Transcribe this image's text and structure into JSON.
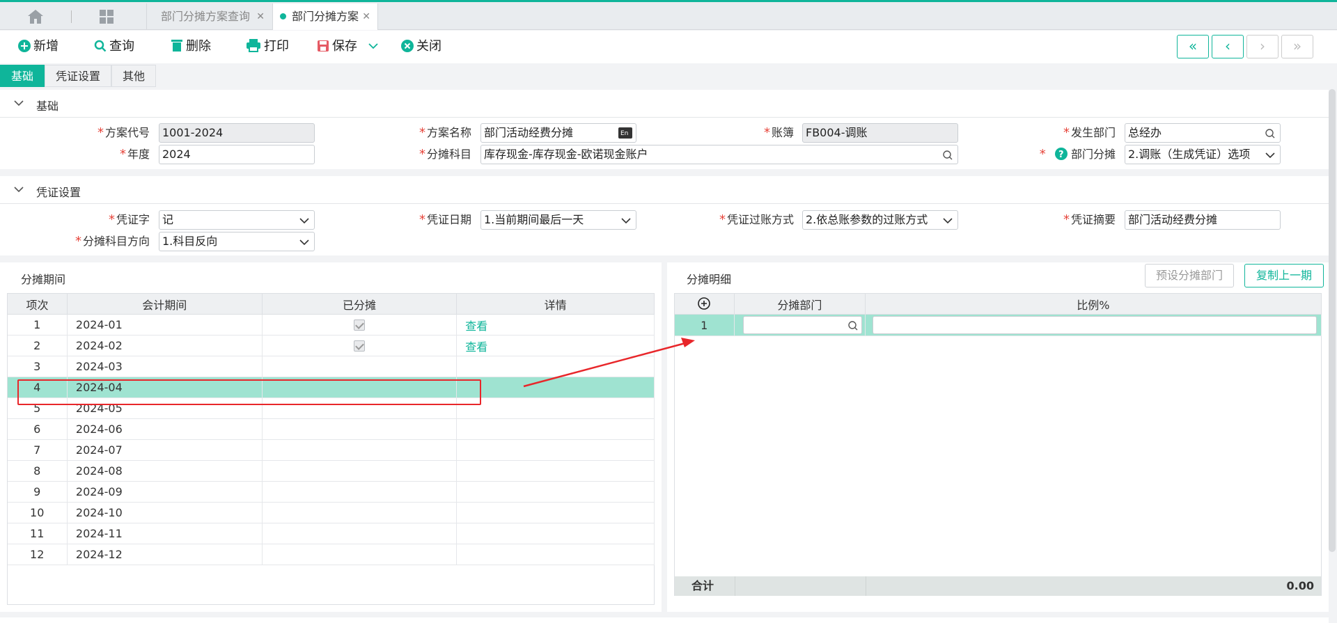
{
  "tabs": {
    "query_label": "部门分摊方案查询",
    "active_label": "部门分摊方案"
  },
  "toolbar": {
    "add": "新增",
    "query": "查询",
    "delete": "删除",
    "print": "打印",
    "save": "保存",
    "close": "关闭"
  },
  "section_tabs": [
    "基础",
    "凭证设置",
    "其他"
  ],
  "basic": {
    "title": "基础",
    "scheme_code_label": "方案代号",
    "scheme_code": "1001-2024",
    "scheme_name_label": "方案名称",
    "scheme_name": "部门活动经费分摊",
    "ledger_label": "账簿",
    "ledger": "FB004-调账",
    "dept_label": "发生部门",
    "dept": "总经办",
    "year_label": "年度",
    "year": "2024",
    "subject_label": "分摊科目",
    "subject": "库存现金-库存现金-欧诺现金账户",
    "dept_alloc_label": "部门分摊",
    "dept_alloc": "2.调账（生成凭证）选项"
  },
  "voucher": {
    "title": "凭证设置",
    "word_label": "凭证字",
    "word": "记",
    "date_label": "凭证日期",
    "date": "1.当前期间最后一天",
    "post_label": "凭证过账方式",
    "post": "2.依总账参数的过账方式",
    "summary_label": "凭证摘要",
    "summary": "部门活动经费分摊",
    "direction_label": "分摊科目方向",
    "direction": "1.科目反向"
  },
  "periods": {
    "title": "分摊期间",
    "headers": [
      "项次",
      "会计期间",
      "已分摊",
      "详情"
    ],
    "view_label": "查看",
    "rows": [
      {
        "no": "1",
        "period": "2024-01",
        "allocated": true,
        "detail": "查看"
      },
      {
        "no": "2",
        "period": "2024-02",
        "allocated": true,
        "detail": "查看"
      },
      {
        "no": "3",
        "period": "2024-03",
        "allocated": false,
        "detail": ""
      },
      {
        "no": "4",
        "period": "2024-04",
        "allocated": false,
        "detail": ""
      },
      {
        "no": "5",
        "period": "2024-05",
        "allocated": false,
        "detail": ""
      },
      {
        "no": "6",
        "period": "2024-06",
        "allocated": false,
        "detail": ""
      },
      {
        "no": "7",
        "period": "2024-07",
        "allocated": false,
        "detail": ""
      },
      {
        "no": "8",
        "period": "2024-08",
        "allocated": false,
        "detail": ""
      },
      {
        "no": "9",
        "period": "2024-09",
        "allocated": false,
        "detail": ""
      },
      {
        "no": "10",
        "period": "2024-10",
        "allocated": false,
        "detail": ""
      },
      {
        "no": "11",
        "period": "2024-11",
        "allocated": false,
        "detail": ""
      },
      {
        "no": "12",
        "period": "2024-12",
        "allocated": false,
        "detail": ""
      }
    ],
    "selected_row": "4"
  },
  "details": {
    "title": "分摊明细",
    "preset_button": "预设分摊部门",
    "copy_button": "复制上一期",
    "headers": [
      "分摊部门",
      "比例%"
    ],
    "row_no": "1",
    "total_label": "合计",
    "total_value": "0.00"
  },
  "colors": {
    "accent": "#0fb59a",
    "selected_row": "#9fe3d1",
    "required": "#e6443a",
    "annotation": "#e8262a"
  }
}
